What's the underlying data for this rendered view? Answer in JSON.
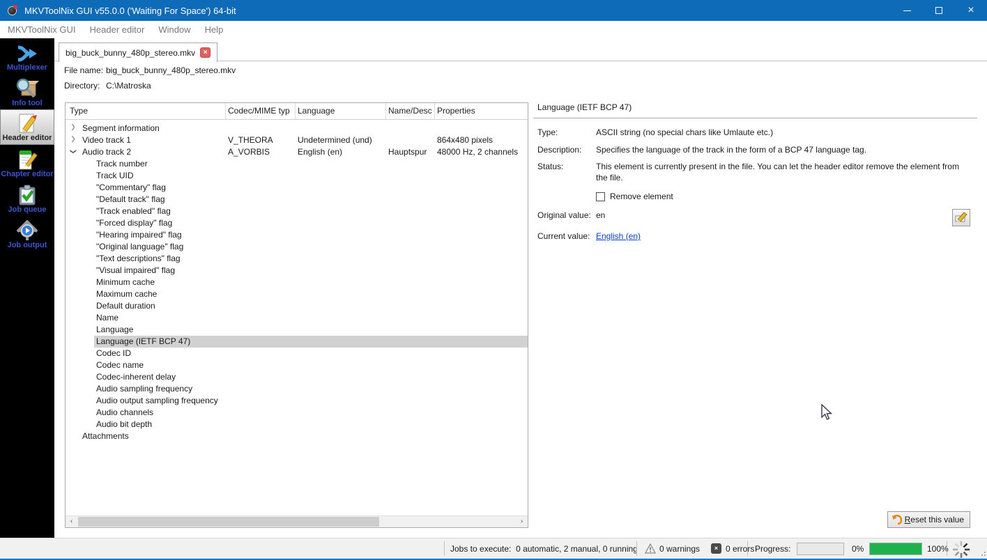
{
  "colors": {
    "accent": "#0e6bb8",
    "progress_green": "#21b14c",
    "link_blue": "#0a3fd0",
    "selected_row": "#d1d1d1",
    "sidebar_label_blue": "#3c55cc"
  },
  "titlebar": {
    "title": "MKVToolNix GUI v55.0.0 ('Waiting For Space') 64-bit",
    "close_glyph": "×"
  },
  "menu": {
    "items": [
      {
        "label": "MKVToolNix GUI"
      },
      {
        "label": "Header editor"
      },
      {
        "label": "Window"
      },
      {
        "label": "Help"
      }
    ]
  },
  "sidebar": {
    "items": [
      {
        "label": "Multiplexer",
        "selected": false
      },
      {
        "label": "Info tool",
        "selected": false
      },
      {
        "label": "Header editor",
        "selected": true
      },
      {
        "label": "Chapter editor",
        "selected": false
      },
      {
        "label": "Job queue",
        "selected": false
      },
      {
        "label": "Job output",
        "selected": false
      }
    ]
  },
  "tab": {
    "label": "big_buck_bunny_480p_stereo.mkv",
    "close_glyph": "×"
  },
  "file_info": {
    "file_name_label": "File name:",
    "file_name_value": "big_buck_bunny_480p_stereo.mkv",
    "directory_label": "Directory:",
    "directory_value": "C:\\Matroska"
  },
  "tree": {
    "columns": [
      {
        "label": "Type"
      },
      {
        "label": "Codec/MIME typ"
      },
      {
        "label": "Language"
      },
      {
        "label": "Name/Desc"
      },
      {
        "label": "Properties"
      }
    ],
    "scroll_left_glyph": "‹",
    "scroll_right_glyph": "›",
    "rows": [
      {
        "level": 0,
        "expander": "collapsed",
        "type": "Segment information",
        "codec": "",
        "language": "",
        "name": "",
        "properties": ""
      },
      {
        "level": 0,
        "expander": "collapsed",
        "type": "Video track 1",
        "codec": "V_THEORA",
        "language": "Undetermined (und)",
        "name": "",
        "properties": "864x480 pixels"
      },
      {
        "level": 0,
        "expander": "expanded",
        "type": "Audio track 2",
        "codec": "A_VORBIS",
        "language": "English (en)",
        "name": "Hauptspur",
        "properties": "48000 Hz, 2 channels"
      },
      {
        "level": 1,
        "expander": "",
        "type": "Track number"
      },
      {
        "level": 1,
        "expander": "",
        "type": "Track UID"
      },
      {
        "level": 1,
        "expander": "",
        "type": "\"Commentary\" flag"
      },
      {
        "level": 1,
        "expander": "",
        "type": "\"Default track\" flag"
      },
      {
        "level": 1,
        "expander": "",
        "type": "\"Track enabled\" flag"
      },
      {
        "level": 1,
        "expander": "",
        "type": "\"Forced display\" flag"
      },
      {
        "level": 1,
        "expander": "",
        "type": "\"Hearing impaired\" flag"
      },
      {
        "level": 1,
        "expander": "",
        "type": "\"Original language\" flag"
      },
      {
        "level": 1,
        "expander": "",
        "type": "\"Text descriptions\" flag"
      },
      {
        "level": 1,
        "expander": "",
        "type": "\"Visual impaired\" flag"
      },
      {
        "level": 1,
        "expander": "",
        "type": "Minimum cache"
      },
      {
        "level": 1,
        "expander": "",
        "type": "Maximum cache"
      },
      {
        "level": 1,
        "expander": "",
        "type": "Default duration"
      },
      {
        "level": 1,
        "expander": "",
        "type": "Name"
      },
      {
        "level": 1,
        "expander": "",
        "type": "Language"
      },
      {
        "level": 1,
        "expander": "",
        "type": "Language (IETF BCP 47)",
        "selected": true
      },
      {
        "level": 1,
        "expander": "",
        "type": "Codec ID"
      },
      {
        "level": 1,
        "expander": "",
        "type": "Codec name"
      },
      {
        "level": 1,
        "expander": "",
        "type": "Codec-inherent delay"
      },
      {
        "level": 1,
        "expander": "",
        "type": "Audio sampling frequency"
      },
      {
        "level": 1,
        "expander": "",
        "type": "Audio output sampling frequency"
      },
      {
        "level": 1,
        "expander": "",
        "type": "Audio channels"
      },
      {
        "level": 1,
        "expander": "",
        "type": "Audio bit depth"
      },
      {
        "level": 0,
        "expander": "",
        "type": "Attachments"
      }
    ]
  },
  "detail": {
    "title": "Language (IETF BCP 47)",
    "type_label": "Type:",
    "type_value": "ASCII string (no special chars like Umlaute etc.)",
    "description_label": "Description:",
    "description_value": "Specifies the language of the track in the form of a BCP 47 language tag.",
    "status_label": "Status:",
    "status_value": "This element is currently present in the file. You can let the header editor remove the element from the file.",
    "remove_checkbox_label": "Remove element",
    "original_label": "Original value:",
    "original_value": "en",
    "current_label": "Current value:",
    "current_value": "English (en)",
    "reset_button_label": "Reset this value"
  },
  "statusbar": {
    "jobs_label": "Jobs to execute:",
    "jobs_value": "0 automatic, 2 manual, 0 running",
    "warnings_text": "0 warnings",
    "errors_text": "0 errors",
    "error_icon_glyph": "×",
    "progress_label": "Progress:",
    "current_progress_text": "0%",
    "current_progress_value": 0,
    "total_progress_text": "100%",
    "total_progress_value": 100
  }
}
